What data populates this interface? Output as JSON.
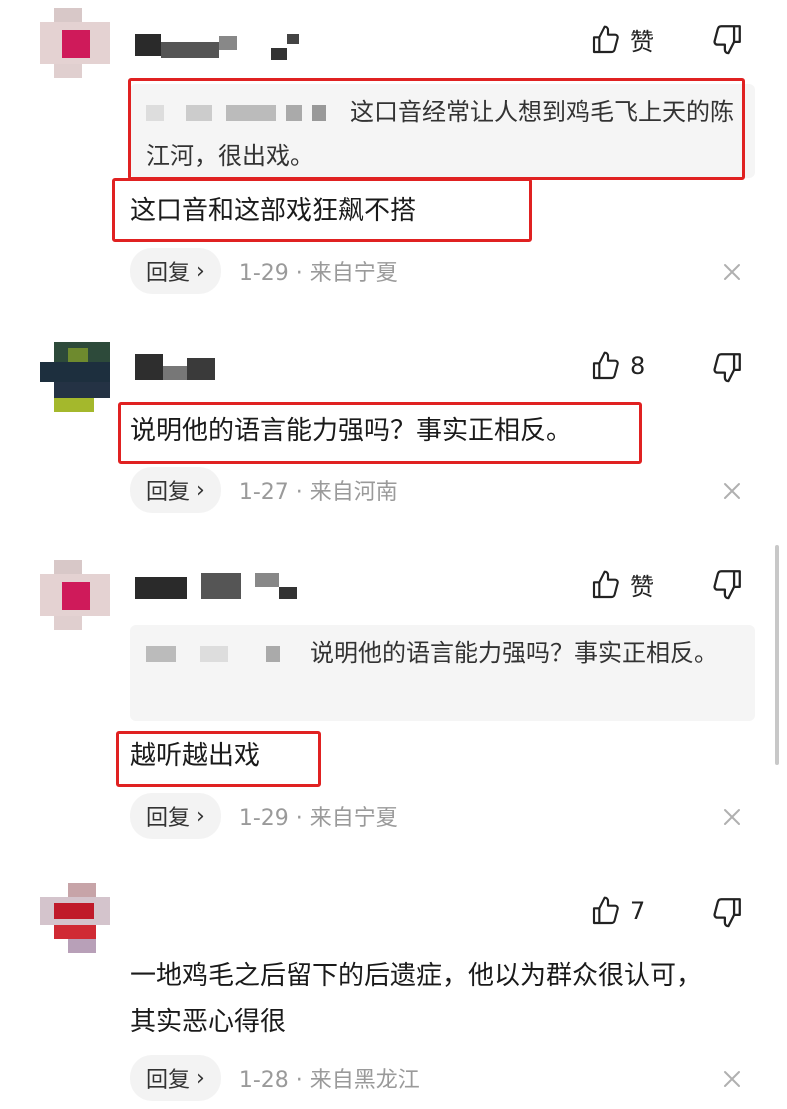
{
  "comments": [
    {
      "like_label": "赞",
      "quote_text": "这口音经常让人想到鸡毛飞上天的陈江河，很出戏。",
      "text": "这口音和这部戏狂飙不搭",
      "reply_label": "回复",
      "meta": "1-29 · 来自宁夏"
    },
    {
      "like_label": "8",
      "text": "说明他的语言能力强吗？事实正相反。",
      "reply_label": "回复",
      "meta": "1-27 · 来自河南"
    },
    {
      "like_label": "赞",
      "quote_text": "说明他的语言能力强吗？事实正相反。",
      "text": "越听越出戏",
      "reply_label": "回复",
      "meta": "1-29 · 来自宁夏"
    },
    {
      "like_label": "7",
      "text": "一地鸡毛之后留下的后遗症，他以为群众很认可，其实恶心得很",
      "reply_label": "回复",
      "meta": "1-28 · 来自黑龙江"
    }
  ],
  "icons": {
    "like": "thumbs-up-icon",
    "dislike": "thumbs-down-icon",
    "close": "close-icon",
    "reply_chevron": "chevron-right-icon"
  },
  "colors": {
    "highlight_box": "#e02121",
    "meta_text": "#9a9a9a",
    "quote_bg": "#f5f5f5"
  }
}
